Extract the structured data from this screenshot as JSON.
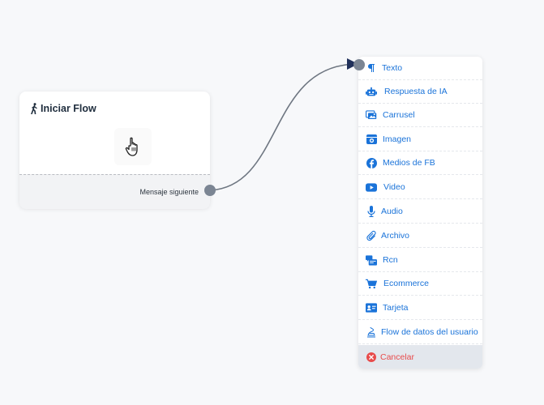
{
  "start_node": {
    "title": "Iniciar Flow",
    "footer_label": "Mensaje siguiente"
  },
  "menu": {
    "items": [
      {
        "label": "Texto",
        "icon": "paragraph-icon"
      },
      {
        "label": "Respuesta de IA",
        "icon": "robot-icon"
      },
      {
        "label": "Carrusel",
        "icon": "images-icon"
      },
      {
        "label": "Imagen",
        "icon": "camera-icon"
      },
      {
        "label": "Medios de FB",
        "icon": "facebook-icon"
      },
      {
        "label": "Video",
        "icon": "youtube-icon"
      },
      {
        "label": "Audio",
        "icon": "microphone-icon"
      },
      {
        "label": "Archivo",
        "icon": "paperclip-icon"
      },
      {
        "label": "Rcn",
        "icon": "rcn-icon"
      },
      {
        "label": "Ecommerce",
        "icon": "cart-icon"
      },
      {
        "label": "Tarjeta",
        "icon": "id-card-icon"
      },
      {
        "label": "Flow de datos del usuario",
        "icon": "layers-icon"
      }
    ],
    "cancel_label": "Cancelar"
  },
  "colors": {
    "accent": "#1a73d9",
    "danger": "#e84b4b",
    "port": "#7b8593",
    "connector": "#6e7681",
    "arrow": "#20305a"
  }
}
